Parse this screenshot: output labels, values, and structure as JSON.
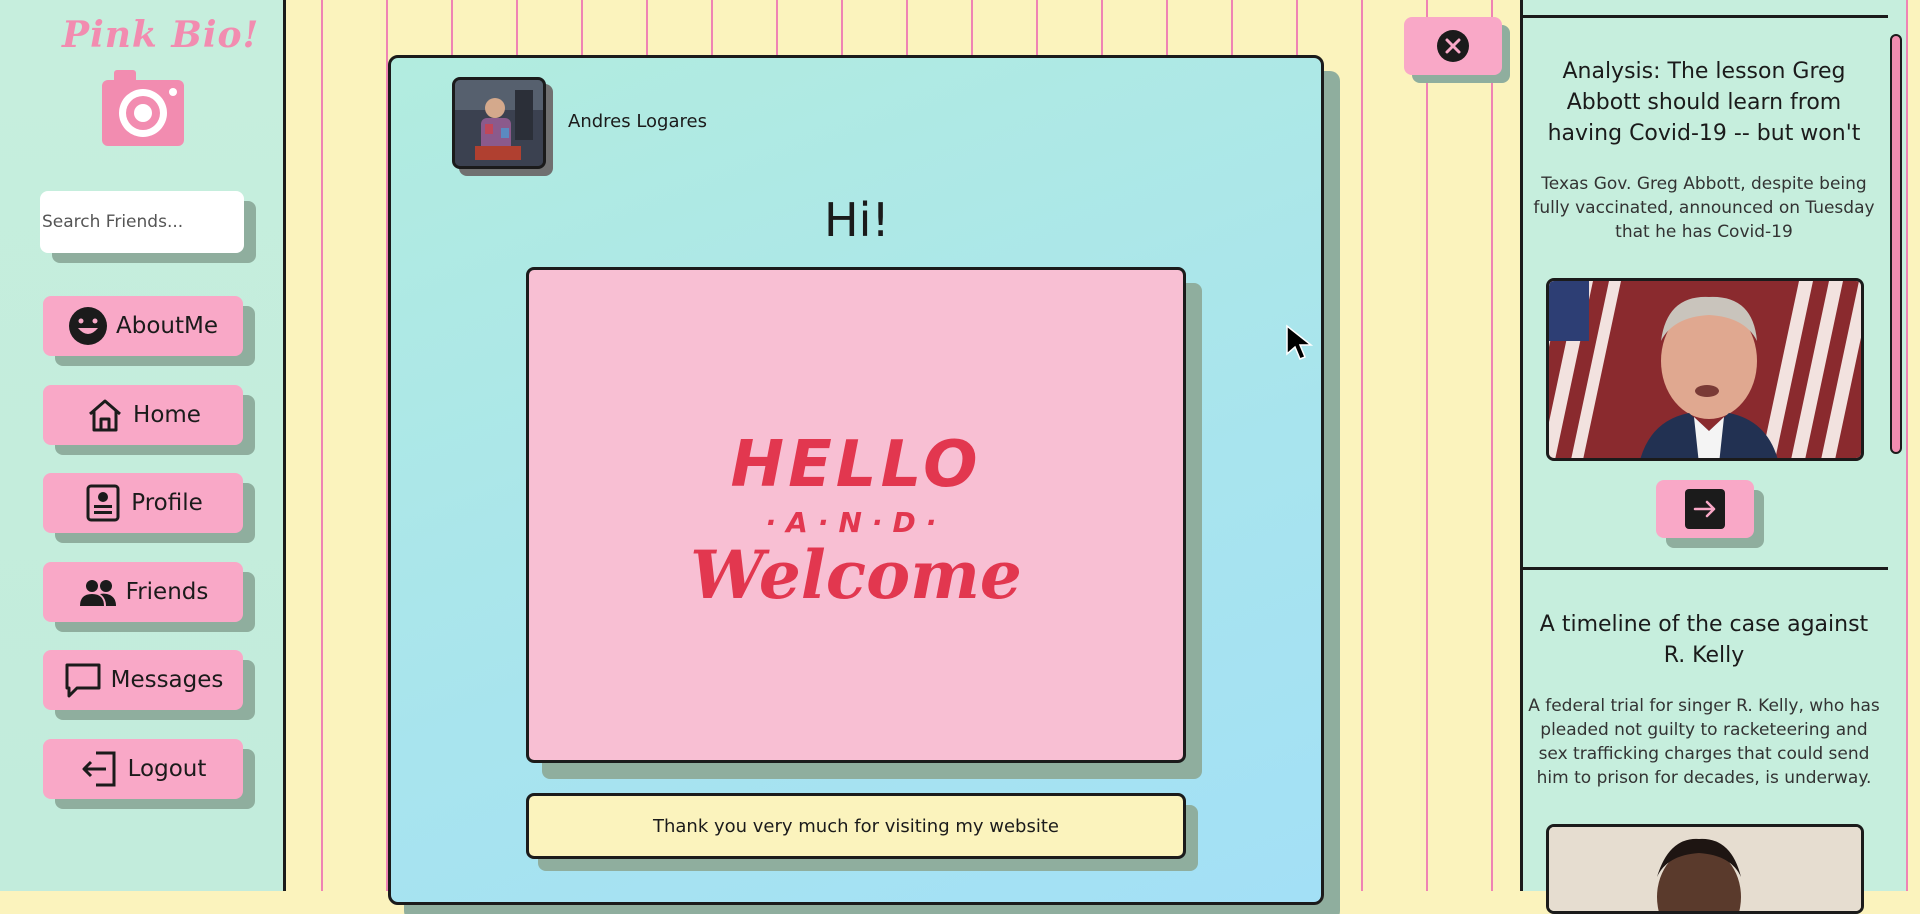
{
  "sidebar": {
    "brand": "Pink Bio!",
    "search_placeholder": "Search Friends...",
    "items": [
      {
        "label": "AboutMe",
        "icon": "smile-face-icon"
      },
      {
        "label": "Home",
        "icon": "house-icon"
      },
      {
        "label": "Profile",
        "icon": "profile-card-icon"
      },
      {
        "label": "Friends",
        "icon": "people-icon"
      },
      {
        "label": "Messages",
        "icon": "chat-bubble-icon"
      },
      {
        "label": "Logout",
        "icon": "logout-icon"
      }
    ]
  },
  "card": {
    "username": "Andres Logares",
    "greeting": "Hi!",
    "welcome_image": {
      "line1": "HELLO",
      "line2": "·A·N·D·",
      "line3": "Welcome"
    },
    "thanks_text": "Thank you very much for visiting my website"
  },
  "news": [
    {
      "title": "Analysis: The lesson Greg Abbott should learn from having Covid-19 -- but won't",
      "description": "Texas Gov. Greg Abbott, despite being fully vaccinated, announced on Tuesday that he has Covid-19"
    },
    {
      "title": "A timeline of the case against R. Kelly",
      "description": "A federal trial for singer R. Kelly, who has pleaded not guilty to racketeering and sex trafficking charges that could send him to prison for decades, is underway."
    }
  ],
  "colors": {
    "pink": "#f9a8c7",
    "mint": "#c6eedd",
    "cream": "#fbf3bd",
    "stripe": "#ef83b4",
    "welcome_red": "#e2374f"
  }
}
